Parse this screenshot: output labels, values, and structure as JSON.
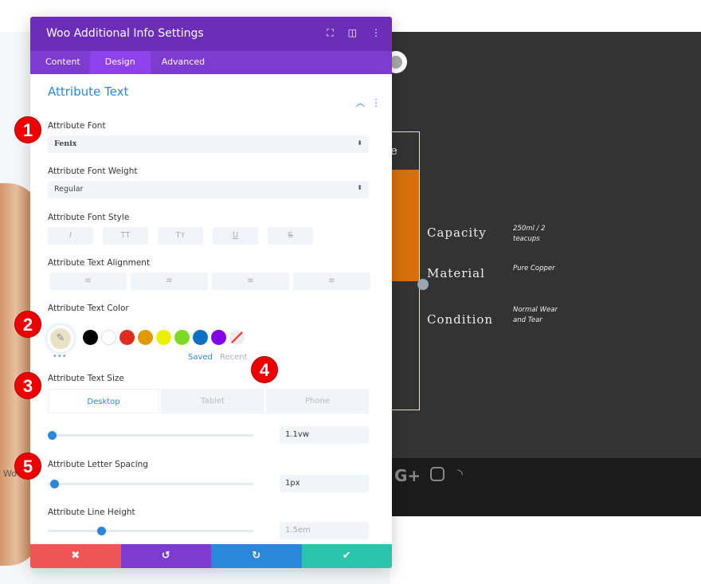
{
  "panel": {
    "title": "Woo Additional Info Settings",
    "tabs": [
      {
        "label": "Content"
      },
      {
        "label": "Design",
        "active": true
      },
      {
        "label": "Advanced"
      }
    ]
  },
  "section": {
    "title": "Attribute Text"
  },
  "fields": {
    "font": {
      "label": "Attribute Font",
      "value": "Fenix"
    },
    "weight": {
      "label": "Attribute Font Weight",
      "value": "Regular"
    },
    "style": {
      "label": "Attribute Font Style",
      "buttons": [
        "I",
        "TT",
        "Tт",
        "U",
        "S"
      ]
    },
    "alignment": {
      "label": "Attribute Text Alignment",
      "buttons": [
        "align-left-icon",
        "align-center-icon",
        "align-right-icon",
        "align-justify-icon"
      ]
    },
    "color": {
      "label": "Attribute Text Color",
      "current": "#eae2c6",
      "swatches": [
        "#000000",
        "#ffffff",
        "#e02b20",
        "#e09900",
        "#edf000",
        "#7cda24",
        "#0c71c3",
        "#8300e9"
      ],
      "saved": "Saved",
      "recent": "Recent"
    },
    "size": {
      "label": "Attribute Text Size",
      "devices": [
        "Desktop",
        "Tablet",
        "Phone"
      ],
      "active_device": "Desktop",
      "value": "1.1vw",
      "slider_fraction": 0.02
    },
    "letter_spacing": {
      "label": "Attribute Letter Spacing",
      "value": "1px",
      "slider_fraction": 0.03
    },
    "line_height": {
      "label": "Attribute Line Height",
      "value": "1.5em",
      "slider_fraction": 0.26
    }
  },
  "markers": [
    "1",
    "2",
    "3",
    "4",
    "5"
  ],
  "page": {
    "header_fragment": "e",
    "attributes": [
      {
        "name": "Capacity",
        "value": "250ml / 2 teacups"
      },
      {
        "name": "Material",
        "value": "Pure Copper"
      },
      {
        "name": "Condition",
        "value": "Normal Wear and Tear"
      }
    ],
    "social_icons": [
      "google-plus-icon",
      "instagram-icon",
      "rss-icon"
    ],
    "left_fragment": "Wo"
  },
  "colors": {
    "header": "#6c2eb9",
    "tabs": "#7e3bd0",
    "accent": "#2b87da",
    "cancel": "#ef5555",
    "undo": "#7e3bd0",
    "redo": "#2b87da",
    "save": "#29c4a9",
    "orange": "#d6700a"
  }
}
